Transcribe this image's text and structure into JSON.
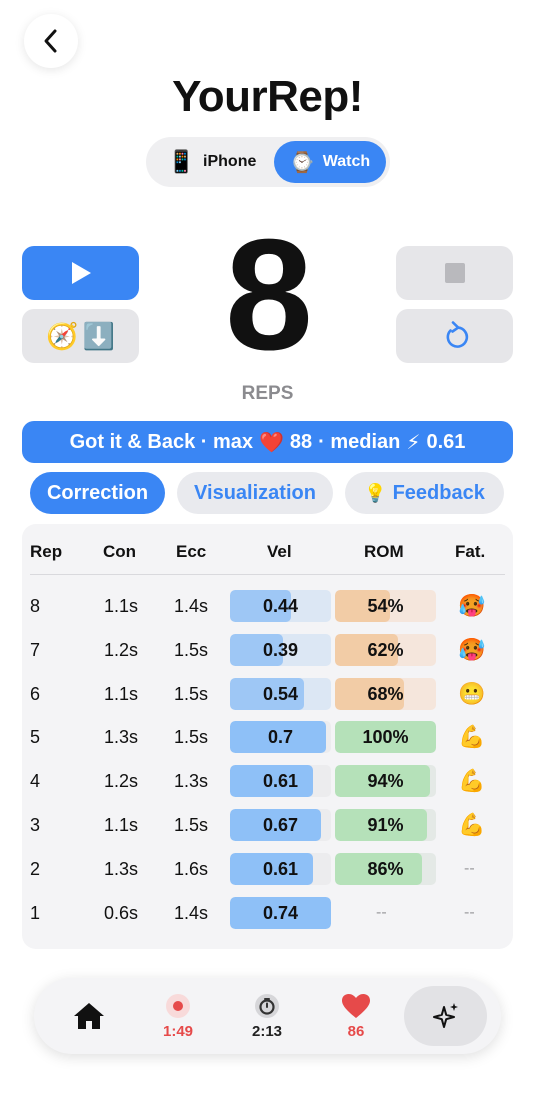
{
  "app": {
    "title": "YourRep!"
  },
  "icons": {
    "back": "chevron-left-icon",
    "play": "play-icon",
    "stop": "stop-icon",
    "reset": "reset-icon",
    "compass": "compass-icon",
    "download": "download-icon"
  },
  "device_toggle": {
    "options": [
      {
        "label": "iPhone",
        "emoji": "📱",
        "selected": false
      },
      {
        "label": "Watch",
        "emoji": "⌚",
        "selected": true
      }
    ]
  },
  "tools": {
    "compass_emoji": "🧭",
    "download_emoji": "⬇️"
  },
  "counter": {
    "count": "8",
    "label": "REPS"
  },
  "summary": {
    "prefix": "Got it & Back · max",
    "heart": "❤️",
    "max_hr": "88",
    "mid": "· median",
    "bolt": "⚡",
    "median": "0.61"
  },
  "tabs": [
    {
      "label": "Correction",
      "active": true,
      "emoji": ""
    },
    {
      "label": "Visualization",
      "active": false,
      "emoji": ""
    },
    {
      "label": "Feedback",
      "active": false,
      "emoji": "💡"
    }
  ],
  "table": {
    "headers": [
      "Rep",
      "Con",
      "Ecc",
      "Vel",
      "ROM",
      "Fat."
    ],
    "rows": [
      {
        "rep": "8",
        "con": "1.1s",
        "ecc": "1.4s",
        "vel": "0.44",
        "vel_fill": 0.6,
        "vel_state": "light",
        "rom": "54%",
        "rom_fill": 0.54,
        "rom_state": "orange",
        "fat": "🥵"
      },
      {
        "rep": "7",
        "con": "1.2s",
        "ecc": "1.5s",
        "vel": "0.39",
        "vel_fill": 0.52,
        "vel_state": "light",
        "rom": "62%",
        "rom_fill": 0.62,
        "rom_state": "orange",
        "fat": "🥵"
      },
      {
        "rep": "6",
        "con": "1.1s",
        "ecc": "1.5s",
        "vel": "0.54",
        "vel_fill": 0.73,
        "vel_state": "light",
        "rom": "68%",
        "rom_fill": 0.68,
        "rom_state": "orange",
        "fat": "😬"
      },
      {
        "rep": "5",
        "con": "1.3s",
        "ecc": "1.5s",
        "vel": "0.7",
        "vel_fill": 0.95,
        "vel_state": "blue",
        "rom": "100%",
        "rom_fill": 1.0,
        "rom_state": "green",
        "fat": "💪"
      },
      {
        "rep": "4",
        "con": "1.2s",
        "ecc": "1.3s",
        "vel": "0.61",
        "vel_fill": 0.82,
        "vel_state": "blue",
        "rom": "94%",
        "rom_fill": 0.94,
        "rom_state": "green",
        "fat": "💪"
      },
      {
        "rep": "3",
        "con": "1.1s",
        "ecc": "1.5s",
        "vel": "0.67",
        "vel_fill": 0.9,
        "vel_state": "blue",
        "rom": "91%",
        "rom_fill": 0.91,
        "rom_state": "green",
        "fat": "💪"
      },
      {
        "rep": "2",
        "con": "1.3s",
        "ecc": "1.6s",
        "vel": "0.61",
        "vel_fill": 0.82,
        "vel_state": "blue",
        "rom": "86%",
        "rom_fill": 0.86,
        "rom_state": "green",
        "fat": "--"
      },
      {
        "rep": "1",
        "con": "0.6s",
        "ecc": "1.4s",
        "vel": "0.74",
        "vel_fill": 1.0,
        "vel_state": "blue",
        "rom": "--",
        "rom_fill": 0,
        "rom_state": "none",
        "fat": "--"
      }
    ]
  },
  "tabbar": {
    "home_icon": "home-icon",
    "record_time": "1:49",
    "timer_time": "2:13",
    "heart_rate": "86",
    "sparkle_icon": "sparkles-icon"
  },
  "colors": {
    "accent": "#3a86f4",
    "vel_blue": "#8ec0f7",
    "vel_light_fill": "#9ec7f5",
    "vel_light_track": "#dce7f4",
    "rom_orange_fill": "#f2cca6",
    "rom_orange_track": "#f5e6dc",
    "rom_green_fill": "#b5e1b9",
    "rom_green_track": "#e4e9e6",
    "record_red": "#e64a4a",
    "heart_red": "#e64a4a"
  }
}
